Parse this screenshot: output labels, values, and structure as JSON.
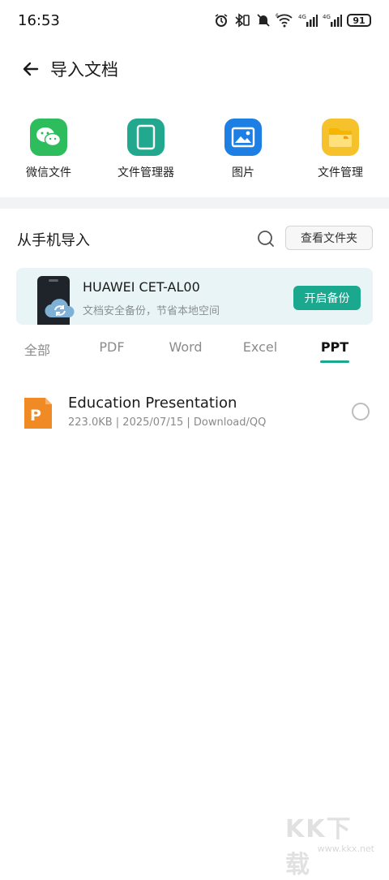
{
  "status_bar": {
    "time": "16:53",
    "battery": "91",
    "signal_1": "4G",
    "signal_2": "4G",
    "wifi_label": "6"
  },
  "header": {
    "title": "导入文档",
    "back_icon": "arrow-left-icon"
  },
  "quick_sources": [
    {
      "label": "微信文件",
      "icon": "wechat-icon",
      "color": "#2dbd5c"
    },
    {
      "label": "文件管理器",
      "icon": "tablet-icon",
      "color": "#22a88f"
    },
    {
      "label": "图片",
      "icon": "image-icon",
      "color": "#1d7fe3"
    },
    {
      "label": "文件管理",
      "icon": "folder-icon",
      "color": "#f5c22b"
    }
  ],
  "import": {
    "title": "从手机导入",
    "search_icon": "search-icon",
    "view_folder_label": "查看文件夹"
  },
  "backup_card": {
    "device_name": "HUAWEI CET-AL00",
    "subtitle": "文档安全备份，节省本地空间",
    "button_label": "开启备份",
    "accent": "#1aa88f"
  },
  "tabs": [
    {
      "label": "全部",
      "active": false
    },
    {
      "label": "PDF",
      "active": false
    },
    {
      "label": "Word",
      "active": false
    },
    {
      "label": "Excel",
      "active": false
    },
    {
      "label": "PPT",
      "active": true
    }
  ],
  "files": [
    {
      "name": "Education Presentation",
      "meta": "223.0KB | 2025/07/15 | Download/QQ",
      "icon": "ppt-file-icon",
      "icon_letter": "P",
      "icon_color": "#f08a24",
      "selected": false
    }
  ],
  "watermark": {
    "text": "KK下载",
    "url": "www.kkx.net"
  }
}
